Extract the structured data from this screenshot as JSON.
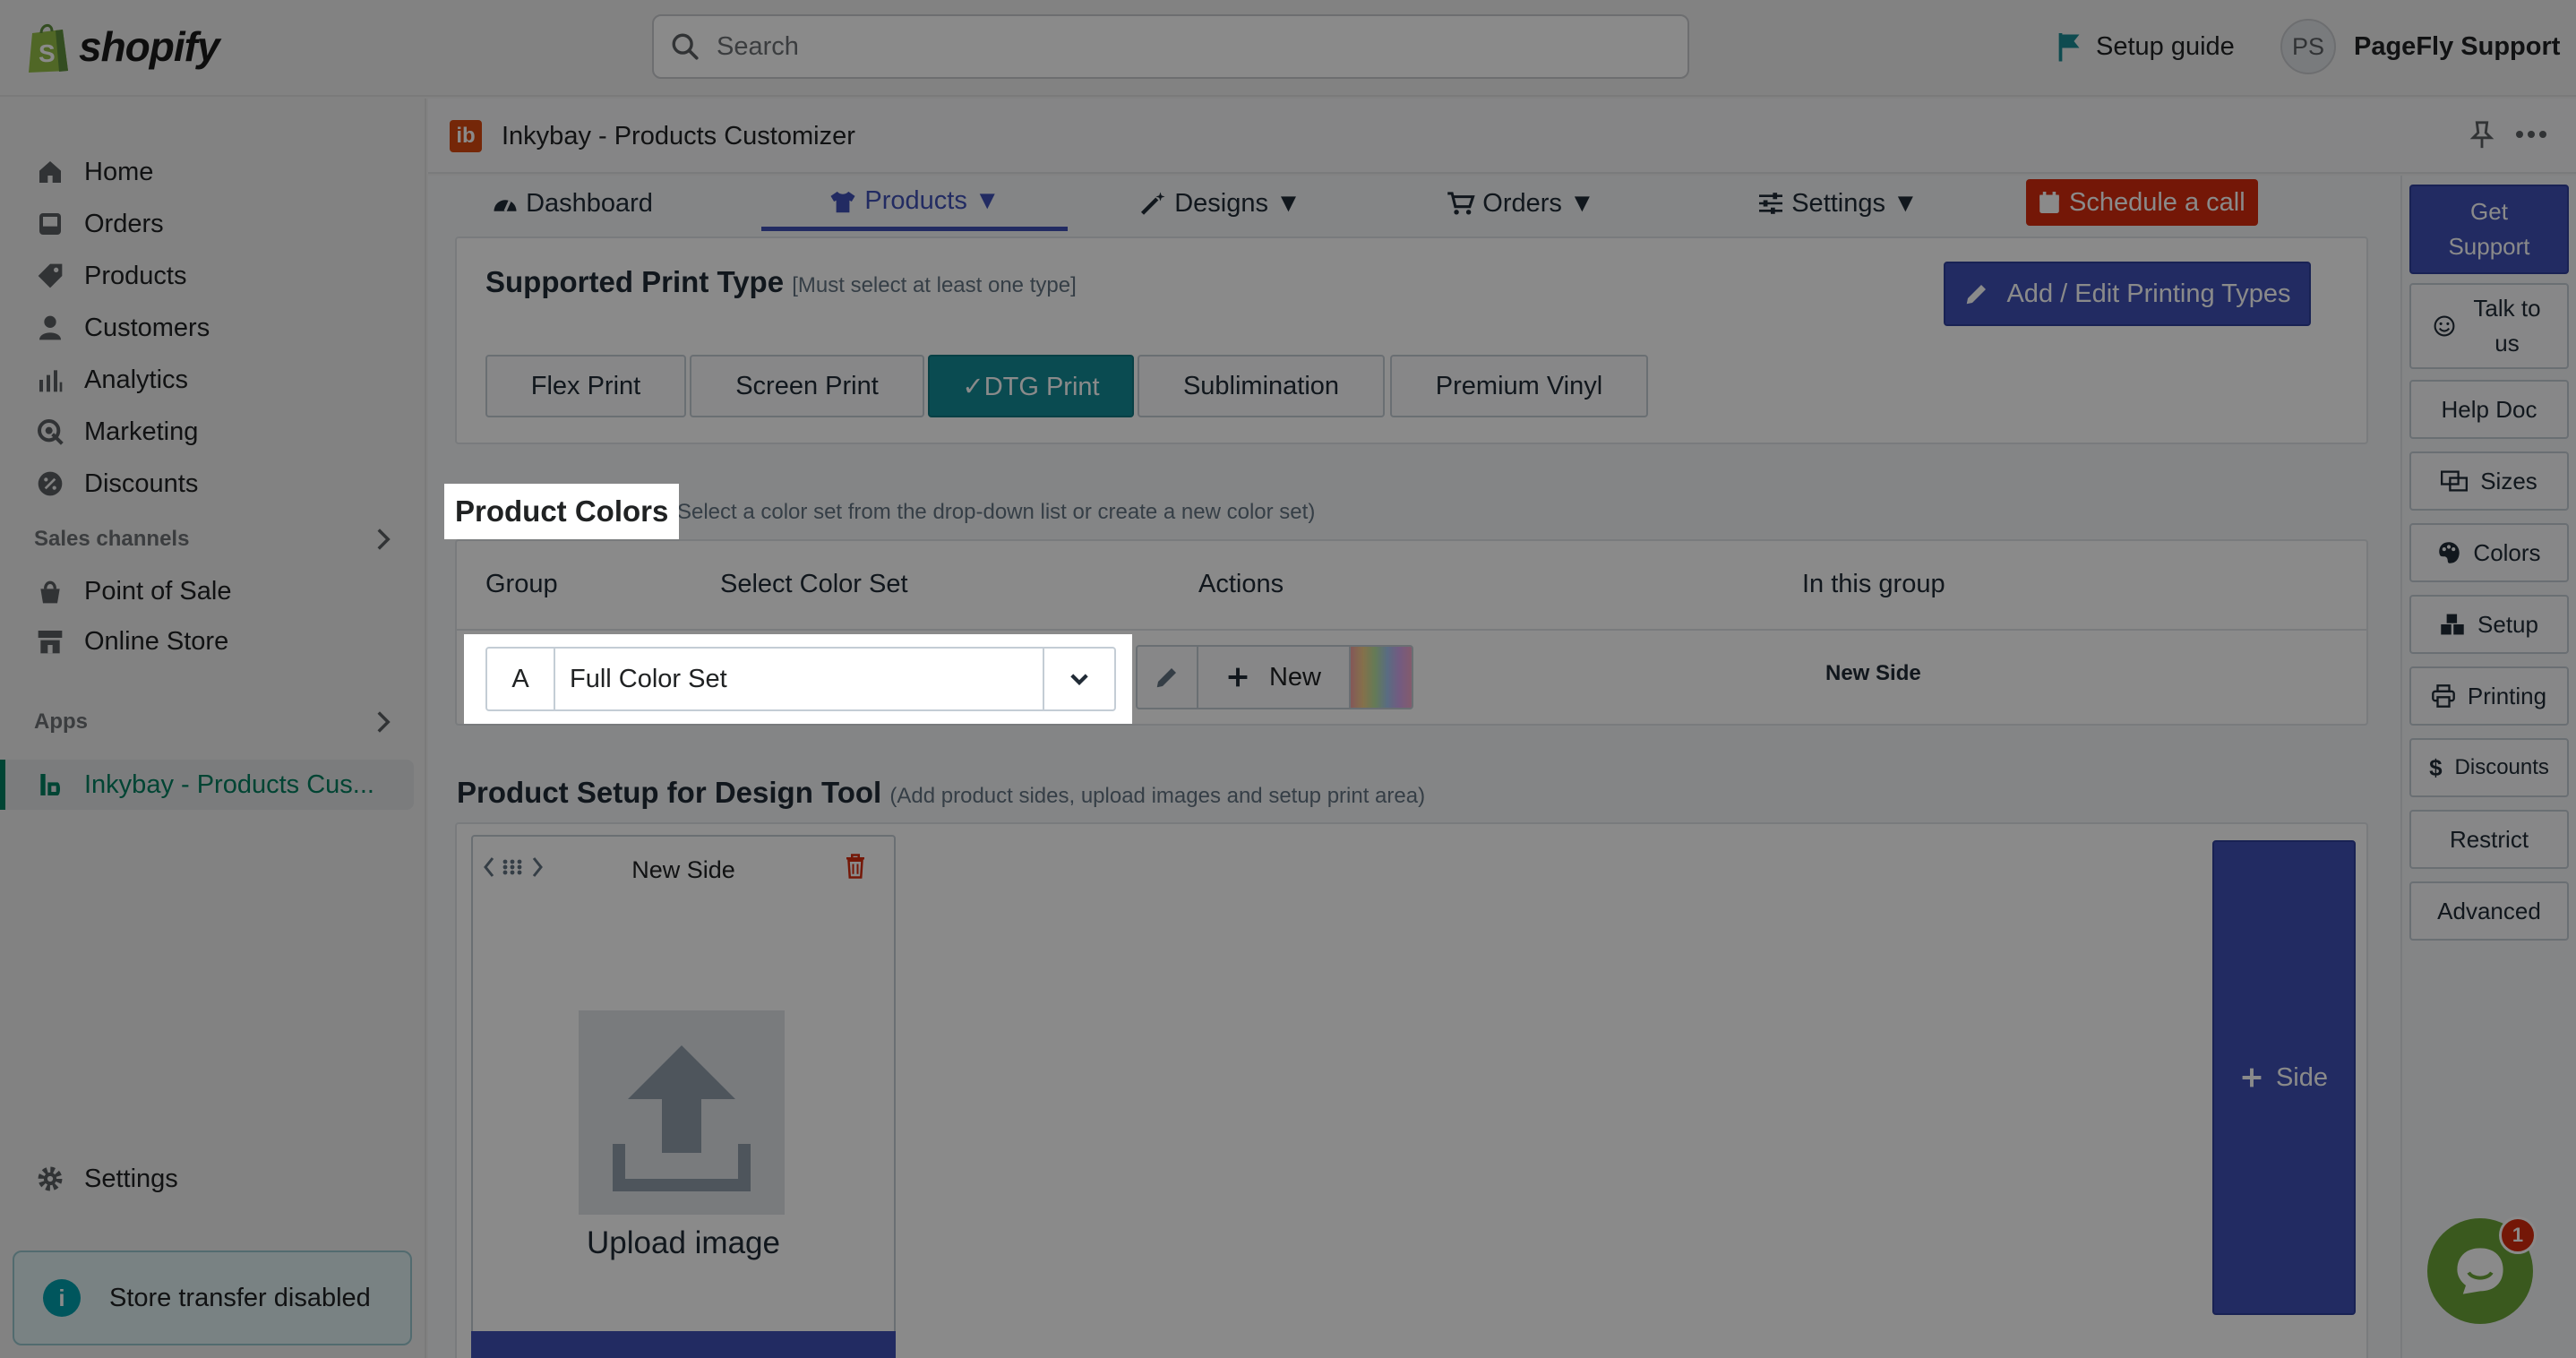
{
  "topbar": {
    "brand": "shopify",
    "search_placeholder": "Search",
    "setup_guide": "Setup guide",
    "user_initials": "PS",
    "user_name": "PageFly Support"
  },
  "sidebar": {
    "items": [
      {
        "label": "Home",
        "icon": "home-icon"
      },
      {
        "label": "Orders",
        "icon": "orders-icon"
      },
      {
        "label": "Products",
        "icon": "tag-icon"
      },
      {
        "label": "Customers",
        "icon": "person-icon"
      },
      {
        "label": "Analytics",
        "icon": "bar-chart-icon"
      },
      {
        "label": "Marketing",
        "icon": "target-icon"
      },
      {
        "label": "Discounts",
        "icon": "discount-icon"
      }
    ],
    "sales_channels_label": "Sales channels",
    "sales_channels": [
      {
        "label": "Point of Sale",
        "icon": "pos-icon"
      },
      {
        "label": "Online Store",
        "icon": "store-icon"
      }
    ],
    "apps_label": "Apps",
    "active_app": "Inkybay - Products Cus...",
    "settings": "Settings",
    "store_transfer": "Store transfer disabled"
  },
  "app": {
    "title": "Inkybay - Products Customizer",
    "tabs": [
      {
        "label": "Dashboard",
        "icon": "dashboard-icon"
      },
      {
        "label": "Products ▼",
        "icon": "tshirt-icon"
      },
      {
        "label": "Designs ▼",
        "icon": "magic-wand-icon"
      },
      {
        "label": "Orders ▼",
        "icon": "cart-icon"
      },
      {
        "label": "Settings ▼",
        "icon": "sliders-icon"
      }
    ],
    "schedule_call": "Schedule a call"
  },
  "print_type": {
    "title": "Supported Print Type",
    "hint": "[Must select at least one type]",
    "edit_button": "Add / Edit Printing Types",
    "options": [
      "Flex Print",
      "Screen Print",
      "✓DTG Print",
      "Sublimination",
      "Premium Vinyl"
    ],
    "selected": "✓DTG Print"
  },
  "product_colors": {
    "title": "Product Colors",
    "hint": "(Select a color set from the drop-down list or create a new color set)",
    "columns": [
      "Group",
      "Select Color Set",
      "Actions",
      "In this group"
    ],
    "row": {
      "group": "A",
      "color_set": "Full Color Set",
      "new_button": "New",
      "in_group": "New Side"
    }
  },
  "product_setup": {
    "title": "Product Setup for Design Tool",
    "hint": "(Add product sides, upload images and setup print area)",
    "side_name": "New Side",
    "upload_label": "Upload image",
    "add_side": "Side"
  },
  "help_panel": {
    "buttons": [
      {
        "label": "Get Support",
        "icon": ""
      },
      {
        "label": "Talk to us",
        "icon": "smiley-icon"
      },
      {
        "label": "Help Doc",
        "icon": ""
      },
      {
        "label": "Sizes",
        "icon": "sizes-icon"
      },
      {
        "label": "Colors",
        "icon": "palette-icon"
      },
      {
        "label": "Setup",
        "icon": "boxes-icon"
      },
      {
        "label": "Printing",
        "icon": "printer-icon"
      },
      {
        "label": "Discounts",
        "icon": "dollar-icon"
      },
      {
        "label": "Restrict",
        "icon": ""
      },
      {
        "label": "Advanced",
        "icon": ""
      }
    ]
  },
  "chat": {
    "badge": "1"
  },
  "colors": {
    "accent": "#3f51b5",
    "selected_print": "#138b96",
    "danger": "#d72c0d",
    "shopify_green": "#008060"
  }
}
